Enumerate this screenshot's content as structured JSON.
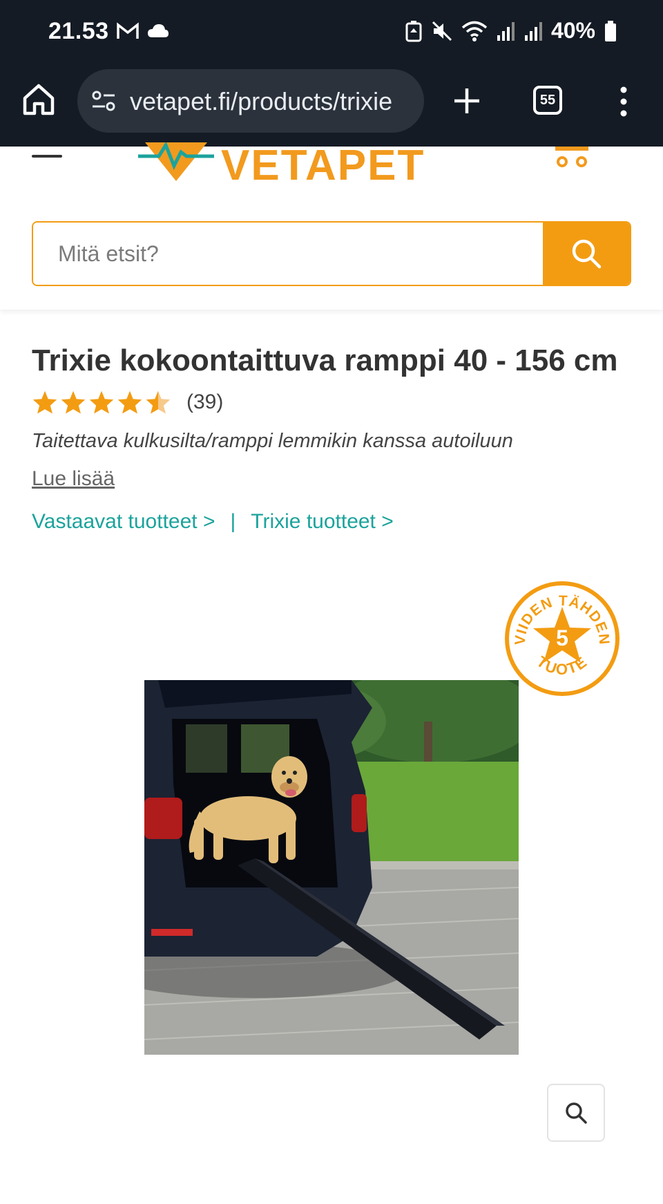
{
  "status_bar": {
    "time": "21.53",
    "battery": "40%"
  },
  "browser": {
    "url": "vetapet.fi/products/trixie",
    "tab_count": "55"
  },
  "site": {
    "logo_text": "VETAPET",
    "search_placeholder": "Mitä etsit?",
    "brand_color": "#f39c12",
    "link_color": "#1ba39c"
  },
  "product": {
    "title": "Trixie kokoontaittuva ramppi 40 - 156 cm",
    "rating": 4.5,
    "review_count": "(39)",
    "subtitle": "Taitettava kulkusilta/ramppi lemmikin kanssa autoiluun",
    "read_more": "Lue lisää",
    "related_link": "Vastaavat tuotteet >",
    "separator": "|",
    "brand_link": "Trixie tuotteet >"
  },
  "badge": {
    "top_text": "VIIDEN TÄHDEN",
    "number": "5",
    "bottom_text": "TUOTE"
  },
  "icons": {
    "home": "home-icon",
    "tune": "site-settings-icon",
    "new_tab": "plus-icon",
    "menu": "more-vert-icon",
    "search": "search-icon",
    "zoom": "zoom-icon",
    "cart": "cart-icon",
    "hamburger": "hamburger-icon"
  }
}
